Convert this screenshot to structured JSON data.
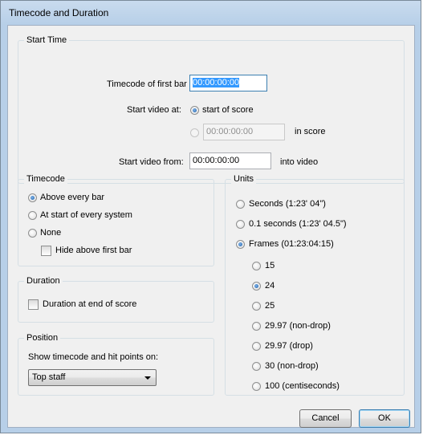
{
  "window": {
    "title": "Timecode and Duration"
  },
  "start_time": {
    "title": "Start Time",
    "timecode_first_bar_label": "Timecode of first bar",
    "timecode_first_bar_value": "00:00:00:00",
    "start_video_at_label": "Start video at:",
    "option_start_of_score": "start of score",
    "in_score_value": "00:00:00:00",
    "in_score_label": "in score",
    "start_video_from_label": "Start video from:",
    "start_video_from_value": "00:00:00:00",
    "into_video_label": "into video"
  },
  "timecode": {
    "title": "Timecode",
    "option_above_every_bar": "Above every bar",
    "option_start_every_system": "At start of every system",
    "option_none": "None",
    "hide_above_first_bar": "Hide above first bar"
  },
  "duration": {
    "title": "Duration",
    "duration_at_end": "Duration at end of score"
  },
  "position": {
    "title": "Position",
    "show_label": "Show timecode and hit points on:",
    "selected": "Top staff"
  },
  "units": {
    "title": "Units",
    "seconds": "Seconds (1:23' 04\")",
    "tenth_seconds": "0.1 seconds (1:23' 04.5\")",
    "frames": "Frames (01:23:04:15)",
    "fps": [
      "15",
      "24",
      "25",
      "29.97 (non-drop)",
      "29.97 (drop)",
      "30 (non-drop)",
      "100 (centiseconds)"
    ],
    "selected_fps": "24"
  },
  "buttons": {
    "cancel": "Cancel",
    "ok": "OK"
  }
}
